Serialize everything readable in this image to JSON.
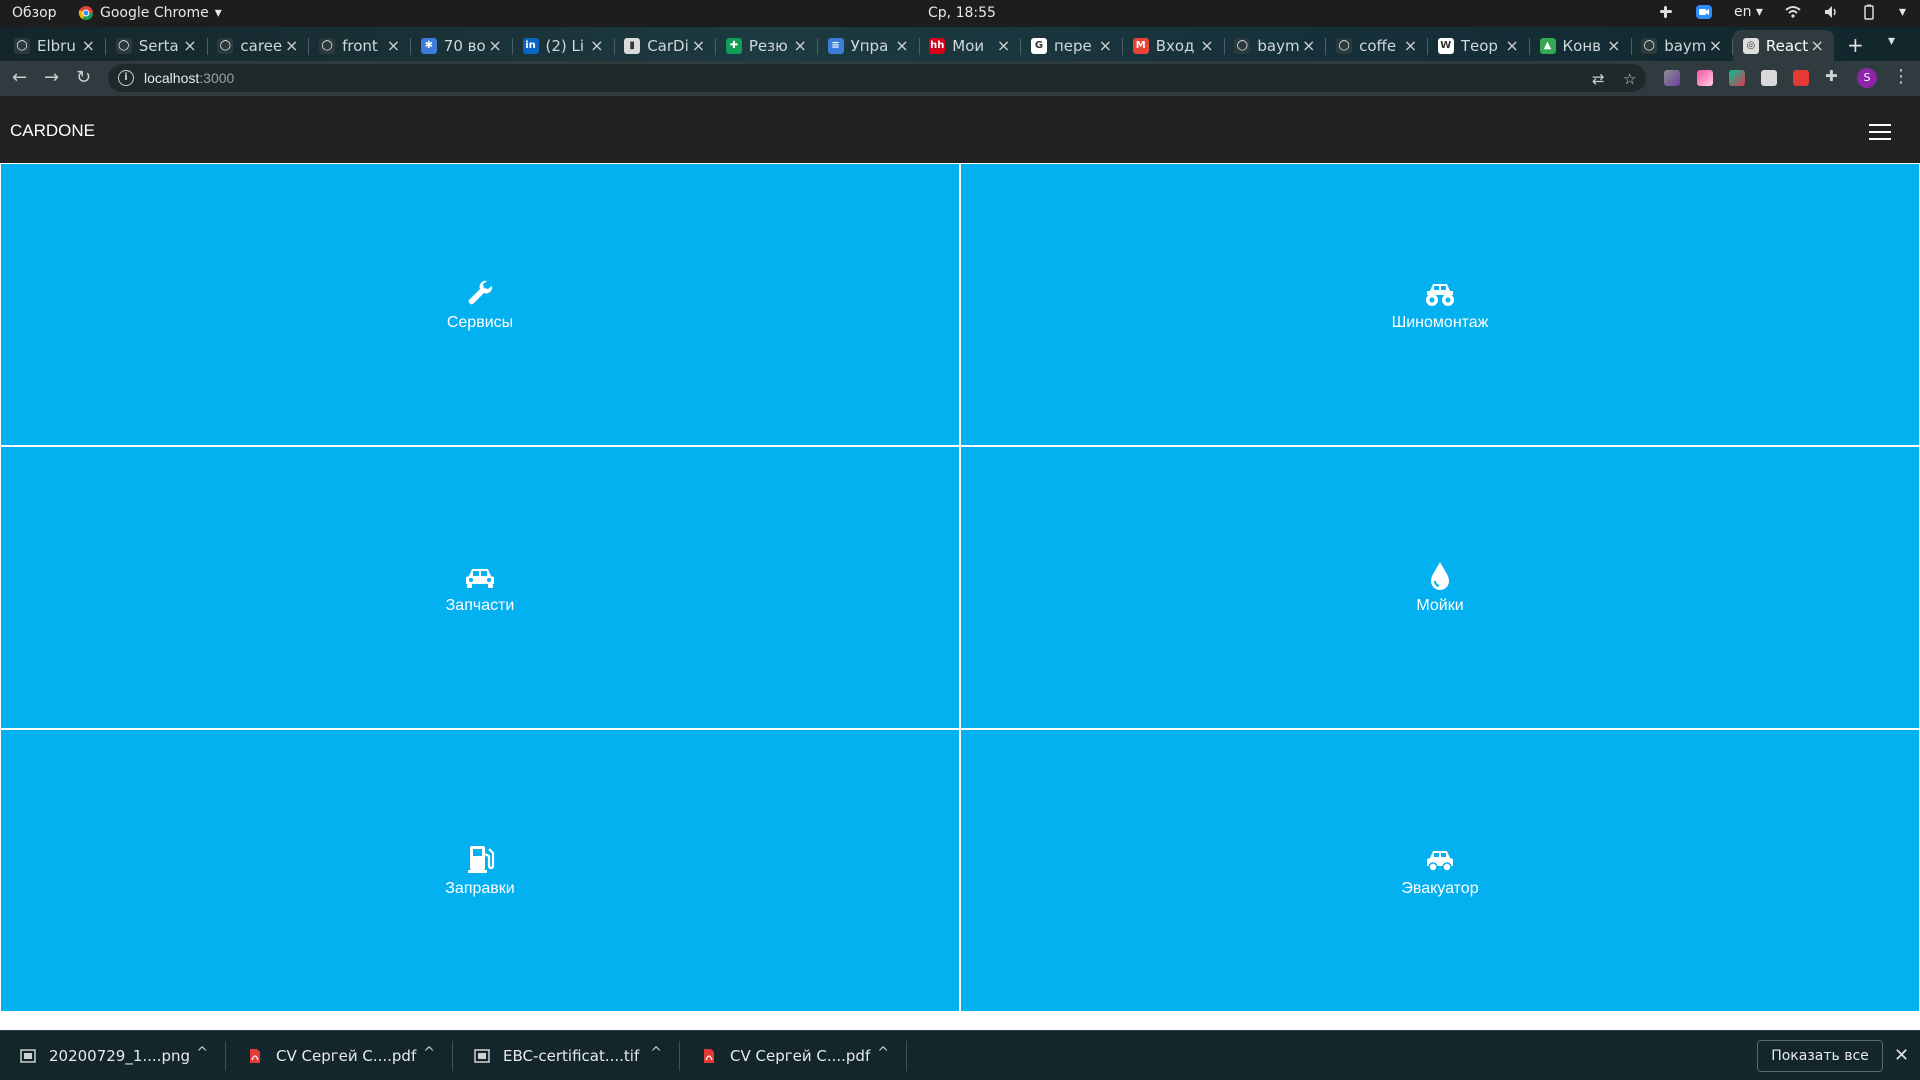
{
  "os": {
    "activities": "Обзор",
    "app_name": "Google Chrome",
    "clock": "Ср, 18:55",
    "language": "en"
  },
  "browser": {
    "tabs": [
      {
        "title": "Elbru",
        "favicon": "github-icon",
        "color": "#2b3a3d"
      },
      {
        "title": "Serta",
        "favicon": "github-icon",
        "color": "#2b3a3d"
      },
      {
        "title": "caree",
        "favicon": "github-icon",
        "color": "#2b3a3d"
      },
      {
        "title": "front",
        "favicon": "github-icon",
        "color": "#2b3a3d"
      },
      {
        "title": "70 во",
        "favicon": "globe-icon",
        "color": "#3b7dd8"
      },
      {
        "title": "(2) Li",
        "favicon": "linkedin-icon",
        "color": "#0a66c2"
      },
      {
        "title": "CarDi",
        "favicon": "trello-icon",
        "color": "#dadada"
      },
      {
        "title": "Резю",
        "favicon": "sheets-icon",
        "color": "#0f9d58"
      },
      {
        "title": "Упра",
        "favicon": "jira-icon",
        "color": "#3b7dd8"
      },
      {
        "title": "Мои",
        "favicon": "hh-icon",
        "color": "#d6001c"
      },
      {
        "title": "пере",
        "favicon": "google-icon",
        "color": "#ffffff"
      },
      {
        "title": "Вход",
        "favicon": "gmail-icon",
        "color": "#ea4335"
      },
      {
        "title": "baym",
        "favicon": "github-icon",
        "color": "#2b3a3d"
      },
      {
        "title": "coffe",
        "favicon": "github-icon",
        "color": "#2b3a3d"
      },
      {
        "title": "Теор",
        "favicon": "wikipedia-icon",
        "color": "#ffffff"
      },
      {
        "title": "Конв",
        "favicon": "drive-icon",
        "color": "#34a853"
      },
      {
        "title": "baym",
        "favicon": "github-icon",
        "color": "#2b3a3d"
      },
      {
        "title": "React",
        "favicon": "react-icon",
        "color": "#dddddd"
      }
    ],
    "url_host": "localhost",
    "url_port": ":3000"
  },
  "app": {
    "brand": "CARDONE",
    "tiles": [
      {
        "label": "Сервисы",
        "icon": "wrench-icon"
      },
      {
        "label": "Шиномонтаж",
        "icon": "monster-truck-icon"
      },
      {
        "label": "Запчасти",
        "icon": "car-icon"
      },
      {
        "label": "Мойки",
        "icon": "water-drop-icon"
      },
      {
        "label": "Заправки",
        "icon": "gas-pump-icon"
      },
      {
        "label": "Эвакуатор",
        "icon": "tow-truck-icon"
      }
    ],
    "tile_color": "#03b0f0"
  },
  "downloads": {
    "items": [
      {
        "name": "20200729_1....png",
        "icon": "image-file-icon"
      },
      {
        "name": "CV Сергей С....pdf",
        "icon": "pdf-file-icon"
      },
      {
        "name": "EBC-certificat....tif",
        "icon": "image-file-icon"
      },
      {
        "name": "CV Сергей С....pdf",
        "icon": "pdf-file-icon"
      }
    ],
    "show_all": "Показать все"
  }
}
